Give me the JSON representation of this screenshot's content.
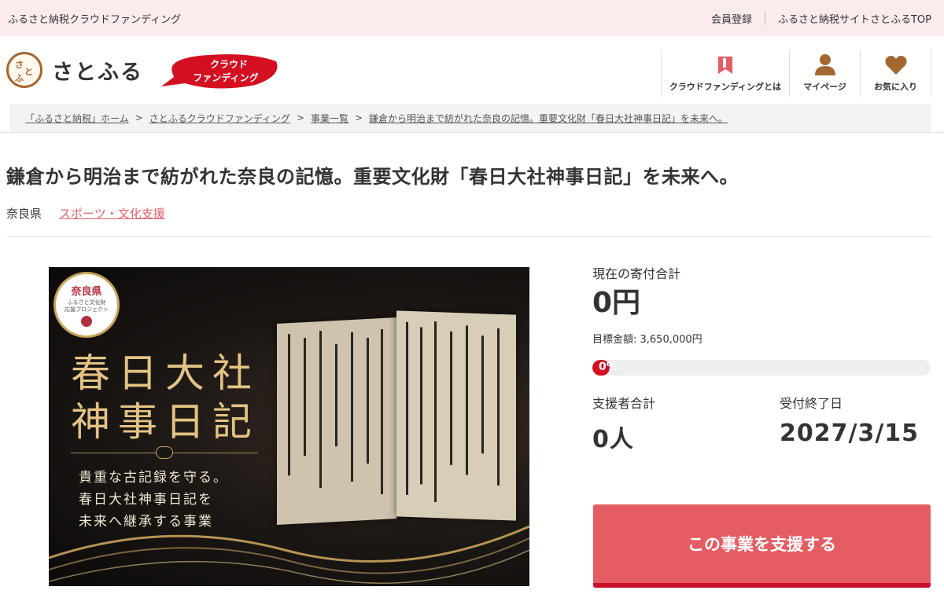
{
  "topbar": {
    "site_name": "ふるさと納税クラウドファンディング",
    "register": "会員登録",
    "satofull_top": "ふるさと納税サイトさとふるTOP"
  },
  "header": {
    "logo_text": "さとふる",
    "badge_line1": "クラウド",
    "badge_line2": "ファンディング",
    "nav": [
      {
        "label": "クラウドファンディングとは",
        "icon": "bookmark-icon"
      },
      {
        "label": "マイページ",
        "icon": "user-icon"
      },
      {
        "label": "お気に入り",
        "icon": "heart-icon"
      }
    ]
  },
  "breadcrumb": [
    "「ふるさと納税」ホーム",
    "さとふるクラウドファンディング",
    "事業一覧",
    "鎌倉から明治まで紡がれた奈良の記憶。重要文化財「春日大社神事日記」を未来へ。"
  ],
  "project": {
    "title": "鎌倉から明治まで紡がれた奈良の記憶。重要文化財「春日大社神事日記」を未来へ。",
    "prefecture": "奈良県",
    "category": "スポーツ・文化支援"
  },
  "hero": {
    "seal_title": "奈良県",
    "seal_sub1": "ふるさと文化財",
    "seal_sub2": "応援プロジェクト",
    "title_line1": "春日大社",
    "title_line2": "神事日記",
    "sub_line1": "貴重な古記録を守る。",
    "sub_line2": "春日大社神事日記を",
    "sub_line3": "未来へ継承する事業"
  },
  "funding": {
    "current_label": "現在の寄付合計",
    "current_amount": "0円",
    "target_label": "目標金額: 3,650,000円",
    "progress_text": "0%",
    "progress_value": 0,
    "supporters_label": "支援者合計",
    "supporters_value": "0人",
    "deadline_label": "受付終了日",
    "deadline_value": "2027/3/15",
    "support_button": "この事業を支援する"
  },
  "colors": {
    "accent": "#e45d63",
    "progress": "#d40f22",
    "category": "#e4606d",
    "topbar_bg": "#fcebec"
  }
}
